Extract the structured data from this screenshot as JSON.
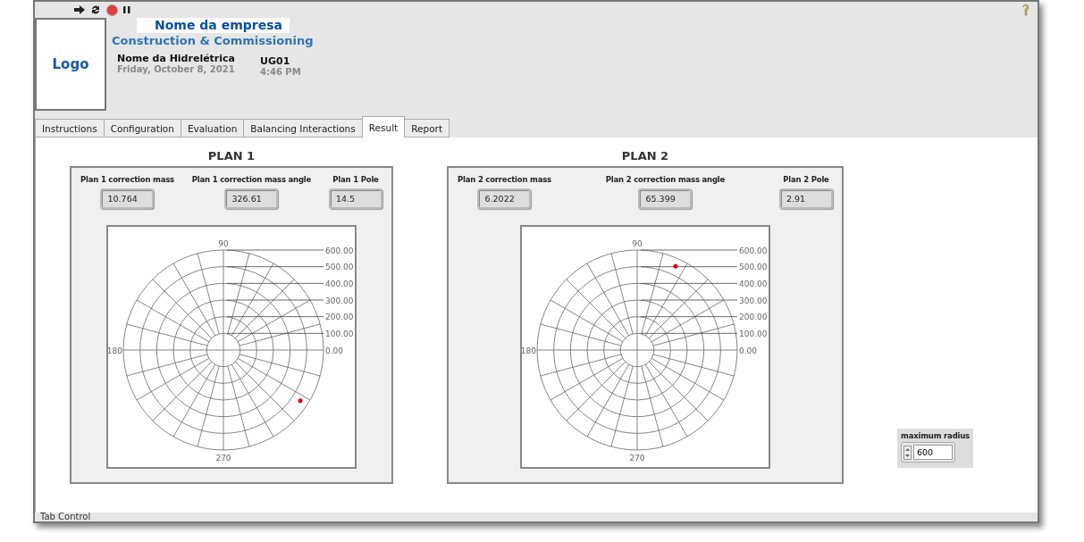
{
  "header": {
    "logo": "Logo",
    "company": "Nome da empresa",
    "subtitle": "Construction & Commissioning",
    "plant": "Nome da Hidrelétrica",
    "date": "Friday, October 8, 2021",
    "unit": "UG01",
    "time": "4:46 PM"
  },
  "tabs": [
    {
      "label": "Instructions",
      "selected": false
    },
    {
      "label": "Configuration",
      "selected": false
    },
    {
      "label": "Evaluation",
      "selected": false
    },
    {
      "label": "Balancing Interactions",
      "selected": false
    },
    {
      "label": "Result",
      "selected": true
    },
    {
      "label": "Report",
      "selected": false
    }
  ],
  "plans": [
    {
      "title": "PLAN 1",
      "fields": [
        {
          "label": "Plan 1 correction mass",
          "value": "10.764"
        },
        {
          "label": "Plan 1 correction mass angle",
          "value": "326.61"
        },
        {
          "label": "Plan 1 Pole",
          "value": "14.5"
        }
      ],
      "polar": {
        "angle_labels": [
          "90",
          "180",
          "270"
        ],
        "radius_labels": [
          "600.00",
          "500.00",
          "400.00",
          "300.00",
          "200.00",
          "100.00",
          "0.00"
        ]
      }
    },
    {
      "title": "PLAN 2",
      "fields": [
        {
          "label": "Plan 2 correction mass",
          "value": "6.2022"
        },
        {
          "label": "Plan 2 correction mass angle",
          "value": "65.399"
        },
        {
          "label": "Plan 2 Pole",
          "value": "2.91"
        }
      ],
      "polar": {
        "angle_labels": [
          "90",
          "180",
          "270"
        ],
        "radius_labels": [
          "600.00",
          "500.00",
          "400.00",
          "300.00",
          "200.00",
          "100.00",
          "0.00"
        ]
      }
    }
  ],
  "max_radius": {
    "label": "maximum radius",
    "value": "600"
  },
  "footer_label": "Tab Control"
}
